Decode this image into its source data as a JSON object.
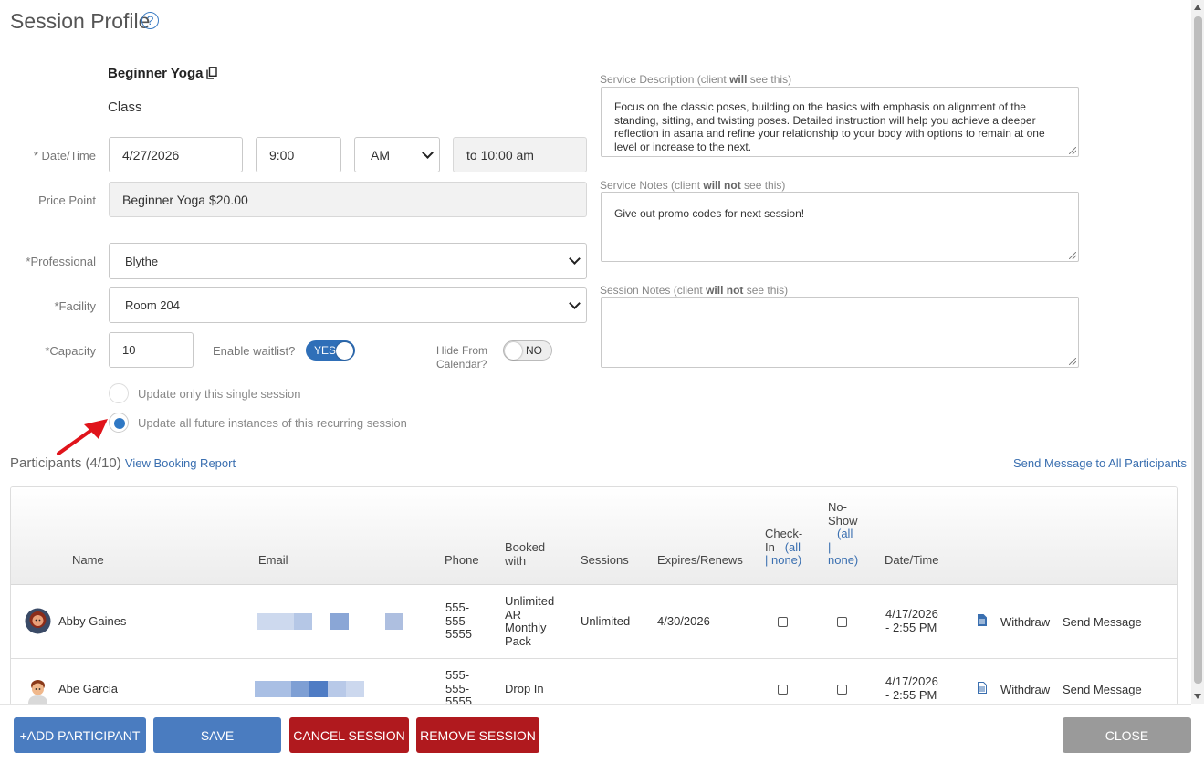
{
  "header": {
    "title": "Session Profile",
    "help_glyph": "?"
  },
  "service": {
    "name": "Beginner Yoga",
    "type": "Class"
  },
  "form": {
    "datetime_label": "* Date/Time",
    "date_value": "4/27/2026",
    "time_value": "9:00",
    "ampm_value": "AM",
    "end_time": "to 10:00 am",
    "price_label": "Price Point",
    "price_value": "Beginner Yoga $20.00",
    "professional_label": "*Professional",
    "professional_value": "Blythe",
    "facility_label": "*Facility",
    "facility_value": "Room 204",
    "capacity_label": "*Capacity",
    "capacity_value": "10",
    "waitlist_label": "Enable waitlist?",
    "waitlist_toggle": "YES",
    "hide_label_1": "Hide From",
    "hide_label_2": "Calendar?",
    "hide_toggle": "NO",
    "radio_single": "Update only this single session",
    "radio_all": "Update all future instances of this recurring session"
  },
  "notes": {
    "desc_label_pre": "Service Description (client ",
    "desc_label_bold": "will",
    "desc_label_post": " see this)",
    "desc_value": "Focus on the classic poses, building on the basics with emphasis on alignment of the standing, sitting, and twisting poses. Detailed instruction will help you achieve a deeper reflection in asana and refine your relationship to your body with options to remain at one level or increase to the next.",
    "svc_notes_label_pre": "Service Notes (client ",
    "svc_notes_label_bold": "will not",
    "svc_notes_label_post": " see this)",
    "svc_notes_value": "Give out promo codes for next session!",
    "session_notes_label_pre": "Session Notes (client ",
    "session_notes_label_bold": "will not",
    "session_notes_label_post": " see this)",
    "session_notes_value": ""
  },
  "participants": {
    "heading": "Participants (4/10)",
    "booking_report": "View Booking Report",
    "send_all": "Send Message to All Participants",
    "columns": {
      "name": "Name",
      "email": "Email",
      "phone": "Phone",
      "booked_1": "Booked",
      "booked_2": "with",
      "sessions": "Sessions",
      "expires": "Expires/Renews",
      "checkin_1": "Check-",
      "checkin_2": "In",
      "checkin_all": "(all",
      "checkin_none": "| none)",
      "noshow_1": "No-",
      "noshow_2": "Show",
      "noshow_all": "(all",
      "noshow_sep": "|",
      "noshow_none": "none)",
      "datetime": "Date/Time"
    },
    "rows": [
      {
        "name": "Abby Gaines",
        "phone": [
          "555-",
          "555-",
          "5555"
        ],
        "booked": [
          "Unlimited",
          "AR",
          "Monthly",
          "Pack"
        ],
        "sessions": "Unlimited",
        "expires": "4/30/2026",
        "date_1": "4/17/2026",
        "date_2": "- 2:55 PM",
        "withdraw": "Withdraw",
        "send": "Send Message"
      },
      {
        "name": "Abe Garcia",
        "phone": [
          "555-",
          "555-",
          "5555"
        ],
        "booked": [
          "Drop In"
        ],
        "sessions": "",
        "expires": "",
        "date_1": "4/17/2026",
        "date_2": "- 2:55 PM",
        "withdraw": "Withdraw",
        "send": "Send Message"
      }
    ]
  },
  "buttons": {
    "add": "+ADD PARTICIPANT",
    "save": "SAVE",
    "cancel": "CANCEL SESSION",
    "remove": "REMOVE SESSION",
    "close": "CLOSE"
  },
  "colors": {
    "accent": "#4a7cc0",
    "danger": "#b0191e",
    "link": "#3a6fb0",
    "toggle_on": "#2f6fb8",
    "arrow": "#e0141b"
  }
}
